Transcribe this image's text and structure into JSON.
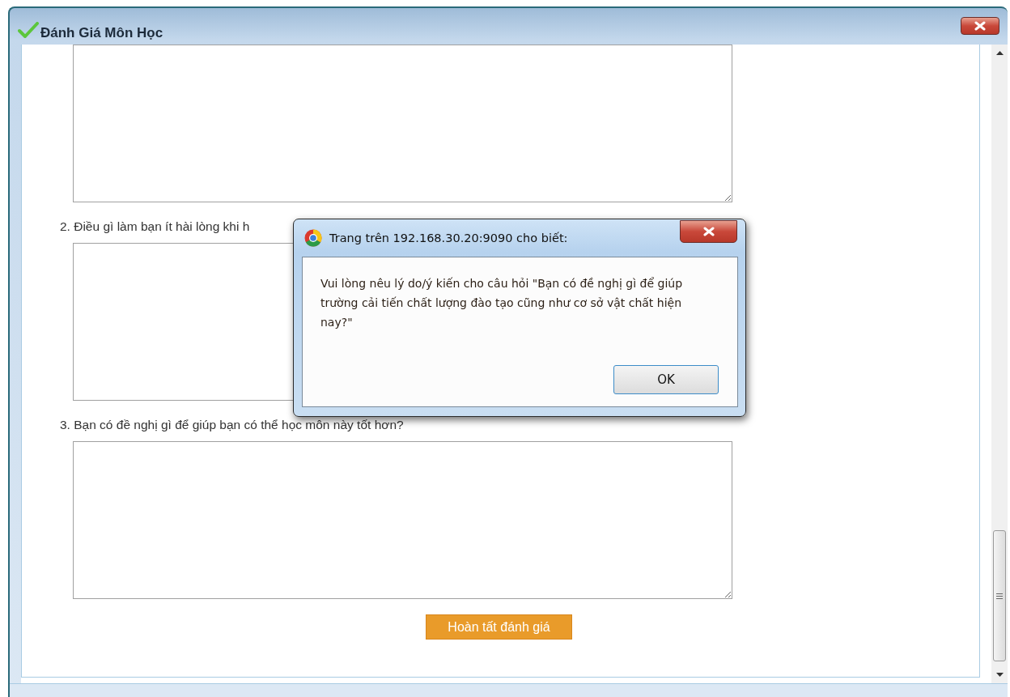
{
  "window": {
    "title": "Đánh Giá Môn Học"
  },
  "questions": [
    {
      "label": "2. Điều gì làm bạn ít hài lòng khi h"
    },
    {
      "label": "3. Bạn có đề nghị gì để giúp bạn có thể học môn này tốt hơn?"
    }
  ],
  "submit_button": "Hoàn tất đánh giá",
  "dialog": {
    "title": "Trang trên 192.168.30.20:9090 cho biết:",
    "message": "Vui lòng nêu lý do/ý kiến cho câu hỏi \"Bạn có đề nghị gì để giúp trường cải tiến chất lượng đào tạo cũng như cơ sở vật chất hiện nay?\"",
    "button": "OK"
  }
}
